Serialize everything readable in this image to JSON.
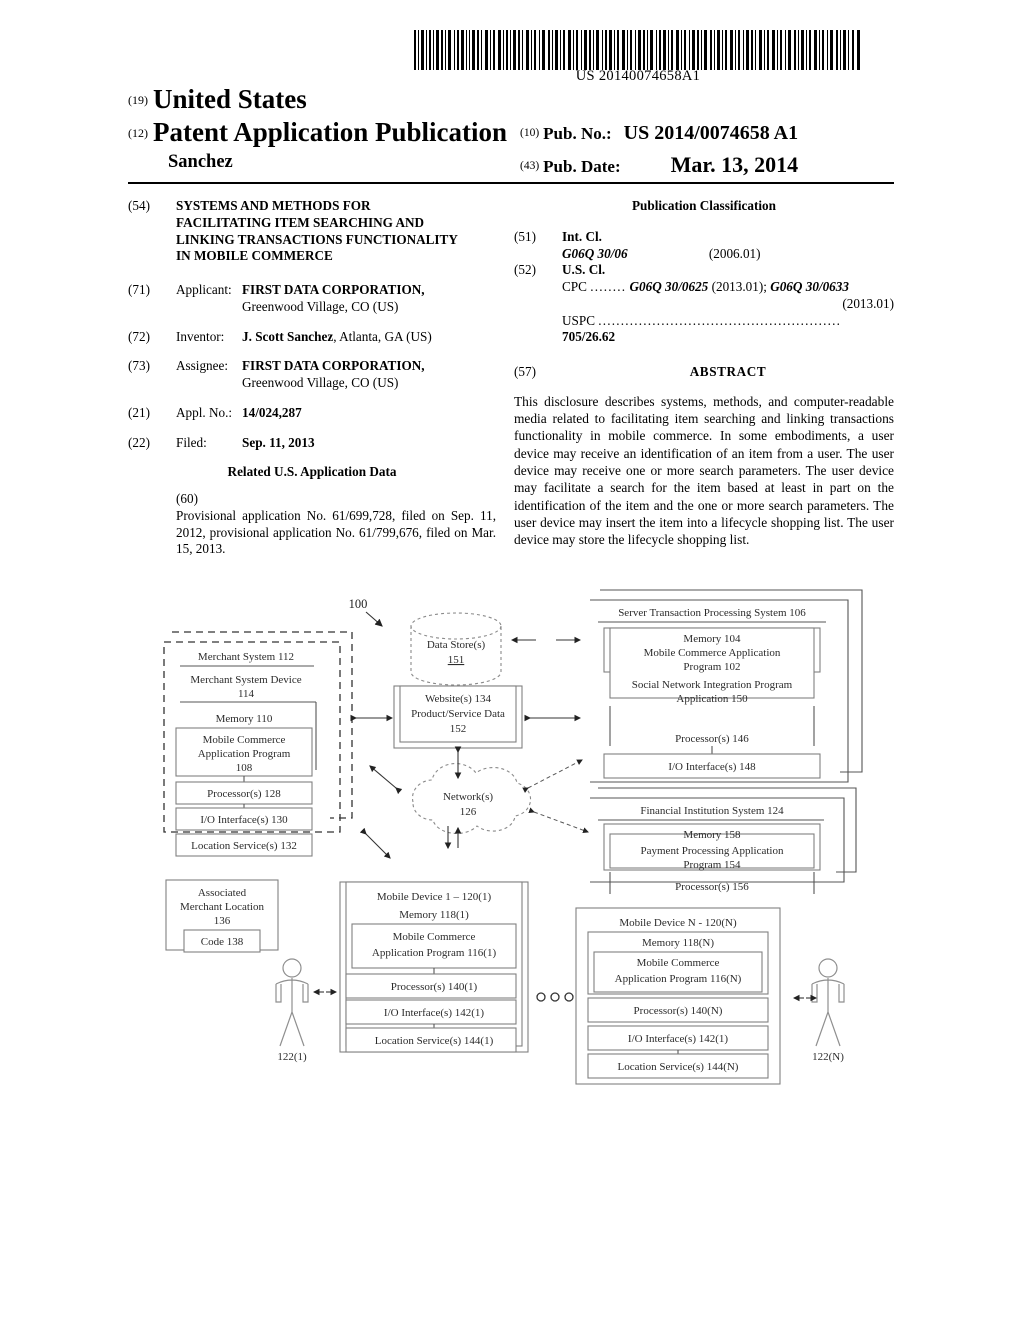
{
  "barcode": {
    "number": "US 20140074658A1"
  },
  "masthead": {
    "country_code": "(19)",
    "country": "United States",
    "doc_type_code": "(12)",
    "doc_type": "Patent Application Publication",
    "inventor_surname": "Sanchez",
    "pub_no_code": "(10)",
    "pub_no_label": "Pub. No.:",
    "pub_no_value": "US 2014/0074658 A1",
    "pub_date_code": "(43)",
    "pub_date_label": "Pub. Date:",
    "pub_date_value": "Mar. 13, 2014"
  },
  "left_column": {
    "title_code": "(54)",
    "title_lines": [
      "SYSTEMS AND METHODS FOR",
      "FACILITATING ITEM SEARCHING AND",
      "LINKING TRANSACTIONS FUNCTIONALITY",
      "IN MOBILE COMMERCE"
    ],
    "applicant_code": "(71)",
    "applicant_label": "Applicant:",
    "applicant_name": "FIRST DATA CORPORATION,",
    "applicant_address": "Greenwood Village, CO (US)",
    "inventor_code": "(72)",
    "inventor_label": "Inventor:",
    "inventor_name": "J. Scott Sanchez",
    "inventor_address": ", Atlanta, GA (US)",
    "assignee_code": "(73)",
    "assignee_label": "Assignee:",
    "assignee_name": "FIRST DATA CORPORATION,",
    "assignee_address": "Greenwood Village, CO (US)",
    "appl_no_code": "(21)",
    "appl_no_label": "Appl. No.:",
    "appl_no_value": "14/024,287",
    "filed_code": "(22)",
    "filed_label": "Filed:",
    "filed_value": "Sep. 11, 2013",
    "related_head": "Related U.S. Application Data",
    "related_code": "(60)",
    "related_text": "Provisional application No. 61/699,728, filed on Sep. 11, 2012, provisional application No. 61/799,676, filed on Mar. 15, 2013."
  },
  "right_column": {
    "pub_class_head": "Publication Classification",
    "int_cl_code": "(51)",
    "int_cl_label": "Int. Cl.",
    "int_cl_value": "G06Q 30/06",
    "int_cl_version": "(2006.01)",
    "us_cl_code": "(52)",
    "us_cl_label": "U.S. Cl.",
    "cpc_label": "CPC",
    "cpc_dots": "........",
    "cpc_value_1": "G06Q 30/0625",
    "cpc_version_1": "(2013.01);",
    "cpc_value_2": "G06Q 30/0633",
    "cpc_version_2": "(2013.01)",
    "uspc_label": "USPC",
    "uspc_dots": "......................................................",
    "uspc_value": "705/26.62",
    "abstract_code": "(57)",
    "abstract_head": "ABSTRACT",
    "abstract_text": "This disclosure describes systems, methods, and computer-readable media related to facilitating item searching and linking transactions functionality in mobile commerce. In some embodiments, a user device may receive an identification of an item from a user. The user device may receive one or more search parameters. The user device may facilitate a search for the item based at least in part on the identification of the item and the one or more search parameters. The user device may insert the item into a lifecycle shopping list. The user device may store the lifecycle shopping list."
  },
  "figure": {
    "diagram_label": "100",
    "merchant_system": {
      "title": "Merchant System 112",
      "device": "Merchant System Device",
      "device_num": "114",
      "memory": "Memory 110",
      "app_line1": "Mobile Commerce",
      "app_line2": "Application Program",
      "app_num": "108",
      "processor": "Processor(s) 128",
      "io": "I/O Interface(s) 130",
      "location": "Location Service(s) 132"
    },
    "data_store": {
      "line1": "Data Store(s)",
      "line2": "151"
    },
    "website": {
      "line1": "Website(s) 134",
      "line2": "Product/Service Data",
      "line3": "152"
    },
    "network": {
      "line1": "Network(s)",
      "line2": "126"
    },
    "server_system": {
      "title": "Server Transaction Processing System 106",
      "memory": "Memory 104",
      "app_line1": "Mobile Commerce Application",
      "app_line2": "Program 102",
      "social_line1": "Social Network Integration Program",
      "social_line2": "Application 150",
      "processor": "Processor(s) 146",
      "io": "I/O Interface(s) 148"
    },
    "financial_system": {
      "title": "Financial Institution System 124",
      "memory": "Memory 158",
      "app_line1": "Payment Processing Application",
      "app_line2": "Program 154",
      "processor": "Processor(s) 156"
    },
    "merchant_location": {
      "line1": "Associated",
      "line2": "Merchant Location",
      "line3": "136",
      "code": "Code 138"
    },
    "mobile_device_1": {
      "title": "Mobile Device 1 – 120(1)",
      "memory": "Memory 118(1)",
      "app_line1": "Mobile Commerce",
      "app_line2": "Application Program 116(1)",
      "processor": "Processor(s) 140(1)",
      "io": "I/O Interface(s) 142(1)",
      "location": "Location Service(s) 144(1)"
    },
    "mobile_device_n": {
      "title": "Mobile Device N - 120(N)",
      "memory": "Memory 118(N)",
      "app_line1": "Mobile Commerce",
      "app_line2": "Application Program 116(N)",
      "processor": "Processor(s) 140(N)",
      "io": "I/O Interface(s) 142(1)",
      "location": "Location Service(s) 144(N)"
    },
    "user_1": "122(1)",
    "user_n": "122(N)",
    "ellipsis": "O O O"
  }
}
